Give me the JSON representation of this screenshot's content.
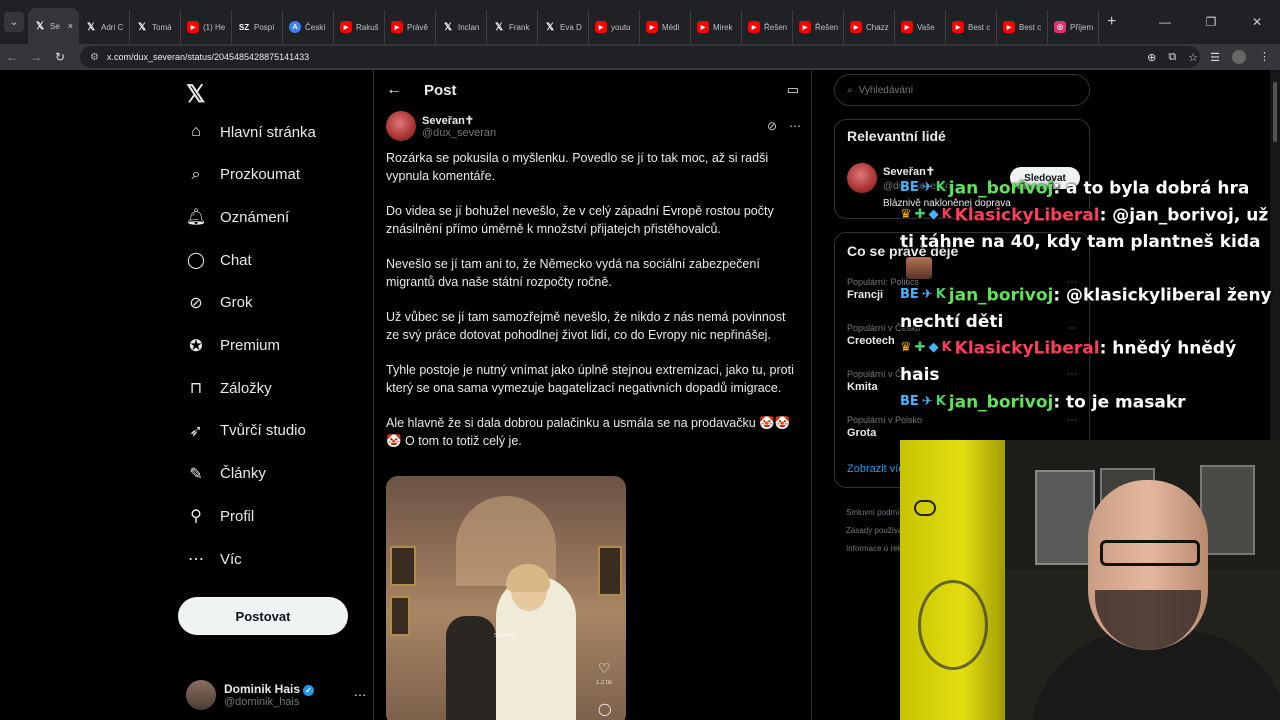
{
  "browser": {
    "tabs": [
      {
        "label": "Se",
        "icon": "x",
        "active": true
      },
      {
        "label": "Adri C",
        "icon": "x"
      },
      {
        "label": "Tomá",
        "icon": "x"
      },
      {
        "label": "(1) He",
        "icon": "yt"
      },
      {
        "label": "Pospí",
        "icon": "szl"
      },
      {
        "label": "Českí",
        "icon": "ai"
      },
      {
        "label": "Rakuš",
        "icon": "yt"
      },
      {
        "label": "Právě",
        "icon": "yt"
      },
      {
        "label": "Inclan",
        "icon": "x"
      },
      {
        "label": "Frank",
        "icon": "x"
      },
      {
        "label": "Eva D",
        "icon": "x"
      },
      {
        "label": "youtu",
        "icon": "yt"
      },
      {
        "label": "Médi",
        "icon": "yt"
      },
      {
        "label": "Mirek",
        "icon": "yt"
      },
      {
        "label": "Řešen",
        "icon": "yt"
      },
      {
        "label": "Řešen",
        "icon": "yt"
      },
      {
        "label": "Chazz",
        "icon": "yt"
      },
      {
        "label": "Vaše",
        "icon": "yt"
      },
      {
        "label": "Best c",
        "icon": "yt"
      },
      {
        "label": "Best c",
        "icon": "yt"
      },
      {
        "label": "Příjem",
        "icon": "ig"
      }
    ],
    "tab_close": "×",
    "new_tab": "+",
    "url": "x.com/dux_severan/status/2045485428875141433",
    "window_controls": {
      "minimize": "—",
      "maximize": "❐",
      "close": "✕"
    }
  },
  "nav": {
    "logo": "𝕏",
    "items": [
      {
        "label": "Hlavní stránka",
        "icon": "home-icon",
        "glyph": "⌂"
      },
      {
        "label": "Prozkoumat",
        "icon": "search-icon",
        "glyph": "⌕"
      },
      {
        "label": "Oznámení",
        "icon": "bell-icon",
        "glyph": "🔔︎"
      },
      {
        "label": "Chat",
        "icon": "chat-icon",
        "glyph": "◯"
      },
      {
        "label": "Grok",
        "icon": "grok-icon",
        "glyph": "⊘"
      },
      {
        "label": "Premium",
        "icon": "premium-icon",
        "glyph": "✪"
      },
      {
        "label": "Záložky",
        "icon": "bookmark-icon",
        "glyph": "⊓"
      },
      {
        "label": "Tvůrčí studio",
        "icon": "rocket-icon",
        "glyph": "➶"
      },
      {
        "label": "Články",
        "icon": "article-icon",
        "glyph": "✎"
      },
      {
        "label": "Profil",
        "icon": "profile-icon",
        "glyph": "⚲"
      },
      {
        "label": "Víc",
        "icon": "more-icon",
        "glyph": "⋯"
      }
    ],
    "post_button": "Postovat",
    "account": {
      "name": "Dominik Hais",
      "handle": "@dominik_hais",
      "more": "⋯"
    }
  },
  "post": {
    "header_title": "Post",
    "author_name": "Seveřan✝",
    "author_handle": "@dux_severan",
    "paragraphs": [
      "Rozárka se pokusila o myšlenku. Povedlo se jí to tak moc, až si radši vypnula komentáře.",
      "Do videa se jí bohužel nevešlo, že v celý západní Evropě rostou počty znásilnění přímo úměrně k množství přijatejch přistěhovalců.",
      "Nevešlo se jí tam ani to, že Německo vydá na sociální zabezpečení migrantů dva naše státní rozpočty ročně.",
      "Už vůbec se jí tam samozřejmě nevešlo, že nikdo z nás nemá povinnost ze svý práce dotovat pohodlnej život lidí, co do Evropy nic nepřinášej.",
      "Tyhle postoje je nutný vnímat jako úplně stejnou extremizaci, jako tu, proti který se ona sama vymezuje bagatelizací negativních dopadů imigrace.",
      "Ale hlavně že si dala dobrou palačinku a usmála se na prodavačku 🤡🤡 🤡 O tom to totiž celý je."
    ],
    "media_caption": "s tema",
    "media_like_count": "1.2 tis",
    "media_like": "♡",
    "media_comment": "◯"
  },
  "sidebar": {
    "search_placeholder": "Vyhledávání",
    "relevant_title": "Relevantní lidé",
    "relevant_name": "Seveřan✝",
    "relevant_handle": "@dux_severan",
    "relevant_bio": "Bláznivě nakloněnej doprava",
    "follow_button": "Sledovat",
    "trends_title": "Co se právě děje",
    "trends": [
      {
        "context": "Populární: Politics",
        "title": "Francji"
      },
      {
        "context": "Populární v Česko",
        "title": "Creotech"
      },
      {
        "context": "Populární v Česko",
        "title": "Kmita"
      },
      {
        "context": "Populární v Polsko",
        "title": "Grota"
      }
    ],
    "show_more": "Zobrazit víc",
    "footer": [
      "Smluvní podmínky",
      "Zásady používání",
      "Informace o reklamách"
    ]
  },
  "stream_chat": [
    {
      "badges": [
        "b-blue",
        "b-blue",
        "b-green"
      ],
      "badge_glyphs": [
        "BE",
        "✈",
        "K"
      ],
      "user": "jan_borivoj",
      "user_color": "green",
      "text": ": a to byla dobrá hra"
    },
    {
      "badges": [
        "b-gold",
        "b-green",
        "b-blue",
        "u-red"
      ],
      "badge_glyphs": [
        "♛",
        "✚",
        "◆",
        "K"
      ],
      "user": "KlasickyLiberal",
      "user_color": "red",
      "text": ": @jan_borivoj, už ti táhne na 40, kdy tam plantneš kida"
    },
    {
      "badges": [
        "b-blue",
        "b-blue",
        "b-green"
      ],
      "badge_glyphs": [
        "BE",
        "✈",
        "K"
      ],
      "user": "jan_borivoj",
      "user_color": "green",
      "text": ": @klasickyliberal ženy nechtí děti"
    },
    {
      "badges": [
        "b-gold",
        "b-green",
        "b-blue",
        "u-red"
      ],
      "badge_glyphs": [
        "♛",
        "✚",
        "◆",
        "K"
      ],
      "user": "KlasickyLiberal",
      "user_color": "red",
      "text": ": hnědý hnědý hais"
    },
    {
      "badges": [
        "b-blue",
        "b-blue",
        "b-green"
      ],
      "badge_glyphs": [
        "BE",
        "✈",
        "K"
      ],
      "user": "jan_borivoj",
      "user_color": "green",
      "text": ": to je masakr"
    }
  ]
}
